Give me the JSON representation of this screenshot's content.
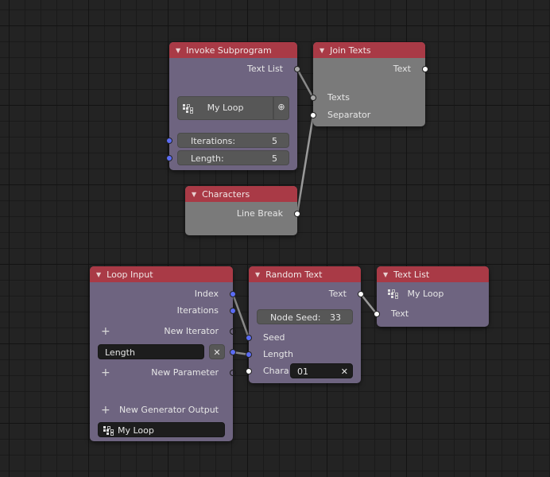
{
  "nodes": {
    "invoke_subprogram": {
      "title": "Invoke Subprogram",
      "output_text_list": "Text List",
      "subprogram": "My Loop",
      "iterations_label": "Iterations:",
      "iterations_value": "5",
      "length_label": "Length:",
      "length_value": "5"
    },
    "join_texts": {
      "title": "Join Texts",
      "output_text": "Text",
      "input_texts": "Texts",
      "input_separator": "Separator"
    },
    "characters": {
      "title": "Characters",
      "output_line_break": "Line Break"
    },
    "loop_input": {
      "title": "Loop Input",
      "output_index": "Index",
      "output_iterations": "Iterations",
      "new_iterator": "New Iterator",
      "parameter_name": "Length",
      "new_parameter": "New Parameter",
      "new_generator_output": "New Generator Output",
      "loop_name": "My Loop"
    },
    "random_text": {
      "title": "Random Text",
      "output_text": "Text",
      "node_seed_label": "Node Seed:",
      "node_seed_value": "33",
      "input_seed": "Seed",
      "input_length": "Length",
      "input_chara": "Chara",
      "chara_value": "01"
    },
    "text_list": {
      "title": "Text List",
      "loop_name": "My Loop",
      "input_text": "Text"
    }
  },
  "icons": {
    "collapse": "▼",
    "plus": "+",
    "clear": "✕",
    "new_subprogram": "new-file-plus"
  },
  "colors": {
    "header": "#a93a46",
    "node_body": "#6e6480",
    "node_grey": "#7a7a7a",
    "socket_blue": "#5b6cf5",
    "socket_white": "#ffffff",
    "socket_grey": "#a9a9a9",
    "background": "#232323"
  }
}
